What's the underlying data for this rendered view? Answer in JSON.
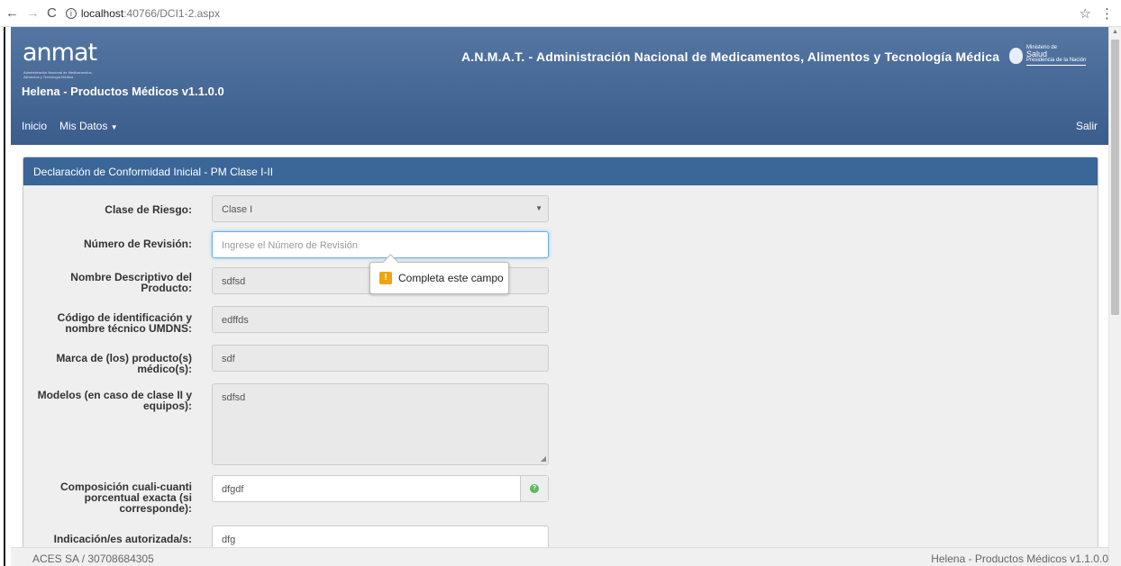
{
  "browser": {
    "back_icon": "←",
    "forward_icon": "→",
    "reload_icon": "C",
    "url_host": "localhost",
    "url_path": ":40766/DCI1-2.aspx",
    "star_icon": "☆",
    "menu_icon": "⋮"
  },
  "header": {
    "logo": "anmat",
    "logo_sub": "Administración Nacional de Medicamentos, Alimentos y Tecnología Médica",
    "app_title": "Helena - Productos Médicos v1.1.0.0",
    "agency": "A.N.M.A.T. - Administración Nacional de Medicamentos, Alimentos y Tecnología Médica",
    "ministry_line1": "Ministerio de",
    "ministry_line2": "Salud",
    "ministry_line3": "Presidencia de la Nación",
    "menu": {
      "home": "Inicio",
      "my_data": "Mis Datos",
      "logout": "Salir"
    }
  },
  "panel": {
    "title": "Declaración de Conformidad Inicial - PM Clase I-II",
    "fields": {
      "risk_class": {
        "label": "Clase de Riesgo:",
        "value": "Clase I"
      },
      "revision": {
        "label": "Número de Revisión:",
        "placeholder": "Ingrese el Número de Revisión"
      },
      "product_name": {
        "label": "Nombre Descriptivo del Producto:",
        "value": "sdfsd"
      },
      "umdns": {
        "label": "Código de identificación y nombre técnico UMDNS:",
        "value": "edffds"
      },
      "brand": {
        "label": "Marca de (los) producto(s) médico(s):",
        "value": "sdf"
      },
      "models": {
        "label": "Modelos (en caso de clase II y equipos):",
        "value": "sdfsd"
      },
      "composition": {
        "label": "Composición cuali-cuanti porcentual exacta (si corresponde):",
        "value": "dfgdf"
      },
      "indications": {
        "label": "Indicación/es autorizada/s:",
        "value": "dfg"
      }
    },
    "tooltip": "Completa este campo"
  },
  "footer": {
    "company": "ACES SA / 30708684305",
    "version": "Helena - Productos Médicos v1.1.0.0"
  }
}
